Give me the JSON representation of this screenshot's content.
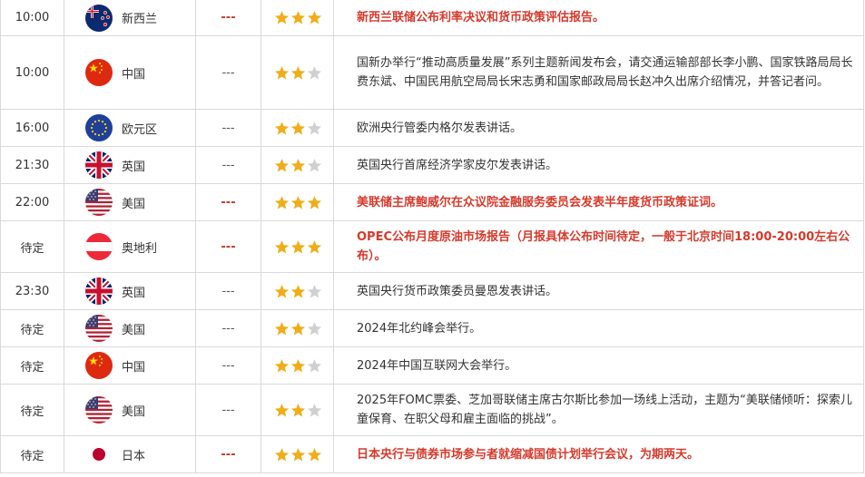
{
  "events": [
    {
      "time": "10:00",
      "flag": "new-zealand",
      "country": "新西兰",
      "importance": "---",
      "stars": 3,
      "high": true,
      "text": "新西兰联储公布利率决议和货币政策评估报告。"
    },
    {
      "time": "10:00",
      "flag": "china",
      "country": "中国",
      "importance": "---",
      "stars": 2,
      "high": false,
      "text": "国新办举行“推动高质量发展”系列主题新闻发布会，请交通运输部部长李小鹏、国家铁路局局长费东斌、中国民用航空局局长宋志勇和国家邮政局局长赵冲久出席介绍情况，并答记者问。"
    },
    {
      "time": "16:00",
      "flag": "eu",
      "country": "欧元区",
      "importance": "---",
      "stars": 2,
      "high": false,
      "text": "欧洲央行管委内格尔发表讲话。"
    },
    {
      "time": "21:30",
      "flag": "uk",
      "country": "英国",
      "importance": "---",
      "stars": 2,
      "high": false,
      "text": "英国央行首席经济学家皮尔发表讲话。"
    },
    {
      "time": "22:00",
      "flag": "usa",
      "country": "美国",
      "importance": "---",
      "stars": 3,
      "high": true,
      "text": "美联储主席鲍威尔在众议院金融服务委员会发表半年度货币政策证词。"
    },
    {
      "time": "待定",
      "flag": "austria",
      "country": "奥地利",
      "importance": "---",
      "stars": 3,
      "high": true,
      "text": "OPEC公布月度原油市场报告（月报具体公布时间待定，一般于北京时间18:00-20:00左右公布）。"
    },
    {
      "time": "23:30",
      "flag": "uk",
      "country": "英国",
      "importance": "---",
      "stars": 2,
      "high": false,
      "text": "英国央行货币政策委员曼恩发表讲话。"
    },
    {
      "time": "待定",
      "flag": "usa",
      "country": "美国",
      "importance": "---",
      "stars": 2,
      "high": false,
      "text": "2024年北约峰会举行。"
    },
    {
      "time": "待定",
      "flag": "china",
      "country": "中国",
      "importance": "---",
      "stars": 2,
      "high": false,
      "text": "2024年中国互联网大会举行。"
    },
    {
      "time": "待定",
      "flag": "usa",
      "country": "美国",
      "importance": "---",
      "stars": 2,
      "high": false,
      "text": "2025年FOMC票委、芝加哥联储主席古尔斯比参加一场线上活动，主题为“美联储倾听：探索儿童保育、在职父母和雇主面临的挑战”。"
    },
    {
      "time": "待定",
      "flag": "japan",
      "country": "日本",
      "importance": "---",
      "stars": 3,
      "high": true,
      "text": "日本央行与债券市场参与者就缩减国债计划举行会议，为期两天。"
    }
  ],
  "colors": {
    "star_full": "#f0ad1a",
    "star_empty": "#d0d0d0",
    "high_text": "#d53a2c",
    "border": "#d9d9d9"
  }
}
